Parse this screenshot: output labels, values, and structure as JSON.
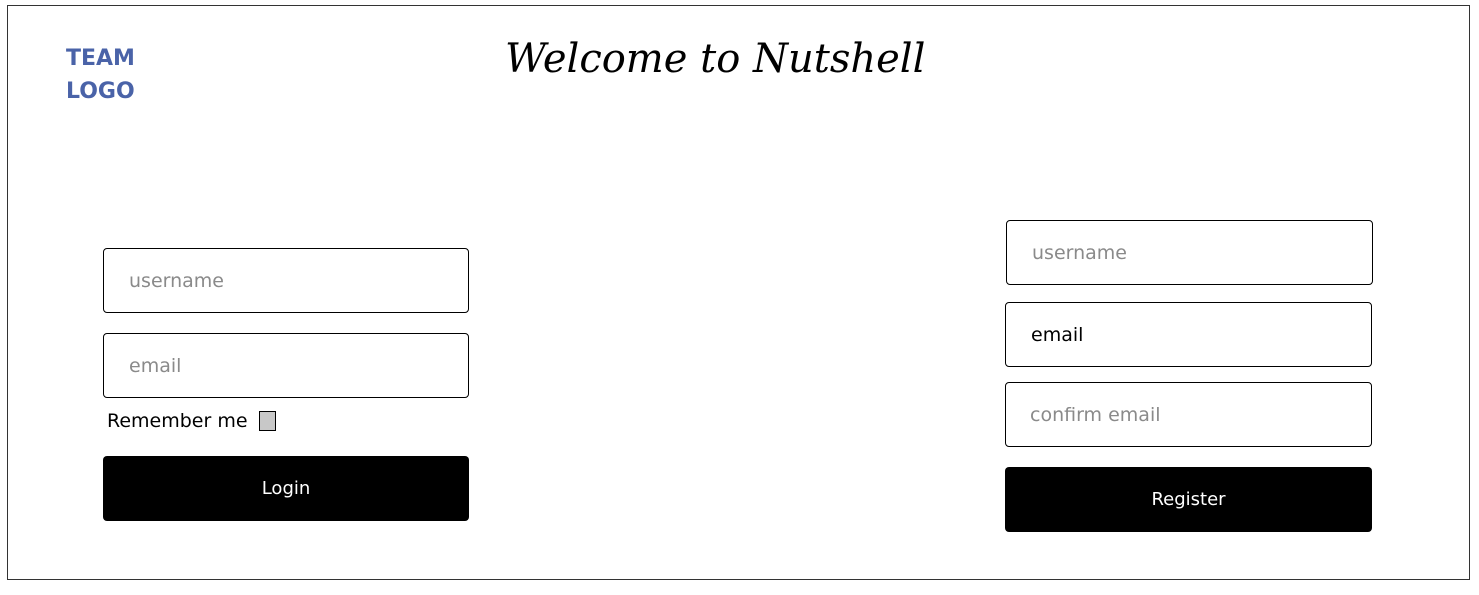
{
  "header": {
    "logo_text": "TEAM LOGO",
    "title": "Welcome to Nutshell"
  },
  "login": {
    "username_placeholder": "username",
    "email_placeholder": "email",
    "remember_label": "Remember me",
    "remember_checked": false,
    "button_label": "Login"
  },
  "register": {
    "username_placeholder": "username",
    "email_value": "email",
    "confirm_email_placeholder": "confirm email",
    "button_label": "Register"
  },
  "colors": {
    "logo": "#4a63a8",
    "button_bg": "#000000",
    "button_text": "#ffffff",
    "checkbox_fill": "#c8c8c8"
  }
}
